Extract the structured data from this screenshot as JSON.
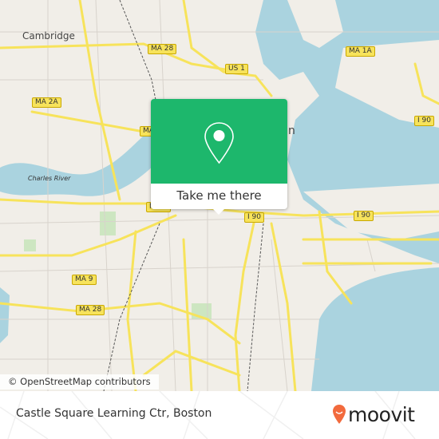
{
  "map": {
    "labels": {
      "cambridge": "Cambridge",
      "charles_river": "Charles River",
      "city_partial": "n"
    },
    "shields": [
      "MA 28",
      "US 1",
      "MA 1A",
      "MA 2A",
      "MA 2A",
      "MA 9",
      "MA 9",
      "I 90",
      "I 90",
      "I 90",
      "MA 28"
    ],
    "colors": {
      "land": "#f1eee8",
      "water": "#aad3df",
      "road": "#f7e35b",
      "park": "#cde6c1"
    }
  },
  "attribution": "© OpenStreetMap contributors",
  "popup": {
    "button_label": "Take me there",
    "icon": "map-pin-icon",
    "color": "#1db76c"
  },
  "footer": {
    "location_name": "Castle Square Learning Ctr, Boston",
    "brand": "moovit",
    "brand_color": "#f26a3d"
  }
}
